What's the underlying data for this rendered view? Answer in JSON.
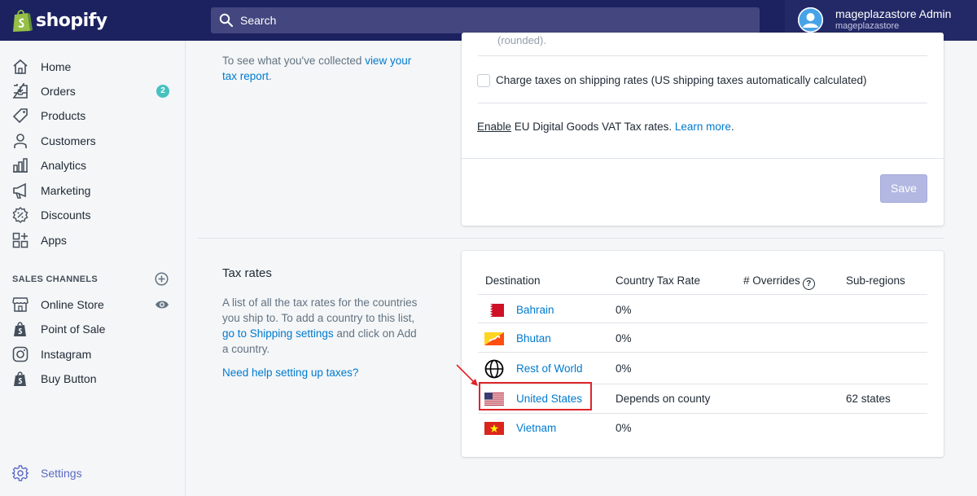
{
  "brand": {
    "name": "shopify"
  },
  "search": {
    "placeholder": "Search"
  },
  "user": {
    "name": "mageplazastore Admin",
    "store": "mageplazastore"
  },
  "sidebar": {
    "items": [
      {
        "label": "Home",
        "icon": "home-icon"
      },
      {
        "label": "Orders",
        "icon": "orders-icon",
        "badge": "2"
      },
      {
        "label": "Products",
        "icon": "tag-icon"
      },
      {
        "label": "Customers",
        "icon": "person-icon"
      },
      {
        "label": "Analytics",
        "icon": "bar-chart-icon"
      },
      {
        "label": "Marketing",
        "icon": "megaphone-icon"
      },
      {
        "label": "Discounts",
        "icon": "discount-icon"
      },
      {
        "label": "Apps",
        "icon": "apps-icon"
      }
    ],
    "sales_channels_title": "SALES CHANNELS",
    "channels": [
      {
        "label": "Online Store",
        "icon": "store-icon"
      },
      {
        "label": "Point of Sale",
        "icon": "pos-bag-icon"
      },
      {
        "label": "Instagram",
        "icon": "instagram-icon"
      },
      {
        "label": "Buy Button",
        "icon": "buy-button-bag-icon"
      }
    ],
    "settings_label": "Settings"
  },
  "tax_settings": {
    "rounded_note": "(rounded).",
    "collected_prefix": "To see what you've collected ",
    "collected_link": "view your tax report",
    "collected_suffix": ".",
    "shipping_checkbox_label": "Charge taxes on shipping rates (US shipping taxes automatically calculated)",
    "shipping_checkbox_checked": false,
    "eu_enable": "Enable",
    "eu_text": " EU Digital Goods VAT Tax rates. ",
    "eu_learn_more": "Learn more",
    "eu_suffix": ".",
    "save_label": "Save"
  },
  "tax_rates": {
    "title": "Tax rates",
    "desc_prefix": "A list of all the tax rates for the countries you ship to. To add a country to this list, ",
    "desc_link": "go to Shipping settings",
    "desc_suffix": " and click on Add a country.",
    "help_link": "Need help setting up taxes?",
    "headers": {
      "destination": "Destination",
      "country_rate": "Country Tax Rate",
      "overrides": "# Overrides",
      "overrides_help": "?",
      "subregions": "Sub-regions"
    },
    "rows": [
      {
        "country": "Bahrain",
        "rate": "0%",
        "subregions": "",
        "flag": "bahrain-flag-icon"
      },
      {
        "country": "Bhutan",
        "rate": "0%",
        "subregions": "",
        "flag": "bhutan-flag-icon"
      },
      {
        "country": "Rest of World",
        "rate": "0%",
        "subregions": "",
        "flag": "globe-icon"
      },
      {
        "country": "United States",
        "rate": "Depends on county",
        "subregions": "62 states",
        "flag": "us-flag-icon"
      },
      {
        "country": "Vietnam",
        "rate": "0%",
        "subregions": "",
        "flag": "vietnam-flag-icon"
      }
    ]
  },
  "colors": {
    "topbar": "#1c2260",
    "link": "#007ace",
    "highlight": "#e0242a",
    "badge": "#47c1bf"
  }
}
